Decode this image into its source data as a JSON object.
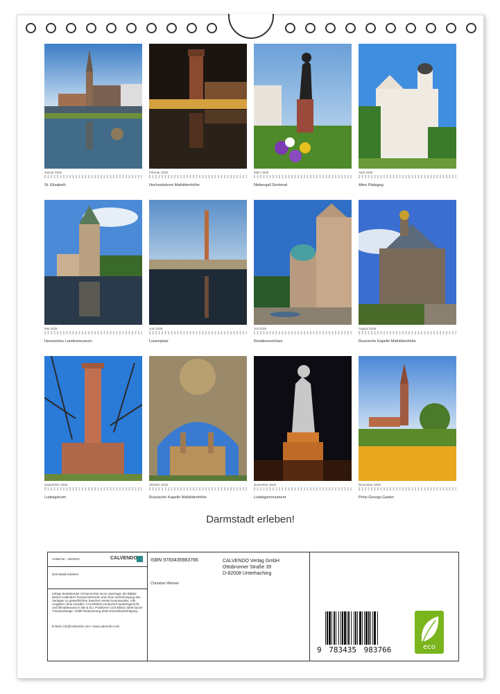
{
  "calendar": {
    "title": "Darmstadt erleben!",
    "pages": [
      {
        "month": "Januar 2026",
        "caption": "St. Elisabeth"
      },
      {
        "month": "Februar 2026",
        "caption": "Hochzeitsturm Mathildenhöhe"
      },
      {
        "month": "März 2026",
        "caption": "Niebergall Denkmal"
      },
      {
        "month": "April 2026",
        "caption": "Altes Pädagog"
      },
      {
        "month": "Mai 2026",
        "caption": "Hessisches Landesmuseum"
      },
      {
        "month": "Juni 2026",
        "caption": "Luisenplatz"
      },
      {
        "month": "Juli 2026",
        "caption": "Residenzschloss"
      },
      {
        "month": "August 2026",
        "caption": "Russische Kapelle Mathildenhöhe"
      },
      {
        "month": "September 2026",
        "caption": "Ludwigsturm"
      },
      {
        "month": "Oktober 2026",
        "caption": "Russische Kapelle Mathildenhöhe"
      },
      {
        "month": "November 2026",
        "caption": "Ludwigsmonument"
      },
      {
        "month": "Dezember 2026",
        "caption": "Prinz-Georgs-Garten"
      }
    ]
  },
  "backcover": {
    "article_no": "Artikel-Nr.: 1824023",
    "brand": "CALVENDO",
    "short_title": "Darmstadt erleben!",
    "legal": "Infolge bestehender Schutzrechte ist es untersagt, die Blätter dieses Kalenders herauszutrennen und ohne Genehmigung des Verlages zu gewerblichen Zwecken weiterzuverwenden. Alle Angaben ohne Gewähr. CALVENDO produziert bedarfsgerecht und klimabewusst in DE & EU. Positivere CO2-Bilanz dank kurzer Transportwege. Abfall-Reduzierung dank Einzelstückfertigung.",
    "contact": "E-Mail: info@calvendo.com • www.calvendo.com",
    "isbn": "ISBN 9783435983766",
    "author": "Christian Werner",
    "publisher": [
      "CALVENDO Verlag GmbH",
      "Ottobrunner Straße 39",
      "D-82008 Unterhaching"
    ],
    "barcode_digits": [
      "9",
      "783435",
      "983766"
    ],
    "eco_label": "eco"
  },
  "colors": {
    "eco_green": "#7ab51d",
    "ring": "#333333"
  }
}
